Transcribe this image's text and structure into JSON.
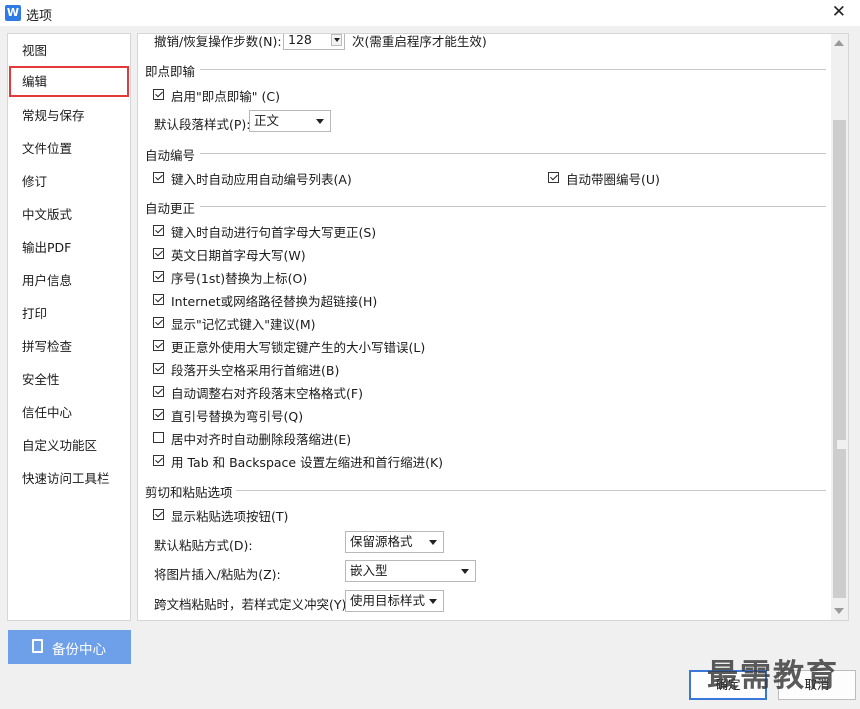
{
  "window": {
    "title": "选项",
    "app_icon_letter": "W",
    "close_glyph": "✕"
  },
  "sidebar": {
    "items": [
      {
        "label": "视图"
      },
      {
        "label": "编辑"
      },
      {
        "label": "常规与保存"
      },
      {
        "label": "文件位置"
      },
      {
        "label": "修订"
      },
      {
        "label": "中文版式"
      },
      {
        "label": "输出PDF"
      },
      {
        "label": "用户信息"
      },
      {
        "label": "打印"
      },
      {
        "label": "拼写检查"
      },
      {
        "label": "安全性"
      },
      {
        "label": "信任中心"
      },
      {
        "label": "自定义功能区"
      },
      {
        "label": "快速访问工具栏"
      }
    ],
    "active_index": 1,
    "backup_label": "备份中心"
  },
  "undo": {
    "label": "撤销/恢复操作步数(N):",
    "value": "128",
    "suffix": "次(需重启程序才能生效)"
  },
  "instant_input": {
    "title": "即点即输",
    "enable_label": "启用\"即点即输\" (C)",
    "enable_checked": true,
    "para_style_label": "默认段落样式(P):",
    "para_style_value": "正文"
  },
  "auto_number": {
    "title": "自动编号",
    "apply_list_label": "键入时自动应用自动编号列表(A)",
    "apply_list_checked": true,
    "circle_number_label": "自动带圈编号(U)",
    "circle_number_checked": true
  },
  "autocorrect": {
    "title": "自动更正",
    "items": [
      {
        "label": "键入时自动进行句首字母大写更正(S)",
        "checked": true
      },
      {
        "label": "英文日期首字母大写(W)",
        "checked": true
      },
      {
        "label": "序号(1st)替换为上标(O)",
        "checked": true
      },
      {
        "label": "Internet或网络路径替换为超链接(H)",
        "checked": true
      },
      {
        "label": "显示\"记忆式键入\"建议(M)",
        "checked": true
      },
      {
        "label": "更正意外使用大写锁定键产生的大小写错误(L)",
        "checked": true
      },
      {
        "label": "段落开头空格采用行首缩进(B)",
        "checked": true
      },
      {
        "label": "自动调整右对齐段落末空格格式(F)",
        "checked": true
      },
      {
        "label": "直引号替换为弯引号(Q)",
        "checked": true
      },
      {
        "label": "居中对齐时自动删除段落缩进(E)",
        "checked": false
      },
      {
        "label": "用 Tab 和 Backspace 设置左缩进和首行缩进(K)",
        "checked": true
      }
    ]
  },
  "paste": {
    "title": "剪切和粘贴选项",
    "show_button_label": "显示粘贴选项按钮(T)",
    "show_button_checked": true,
    "default_label": "默认粘贴方式(D):",
    "default_value": "保留源格式",
    "image_label": "将图片插入/粘贴为(Z):",
    "image_value": "嵌入型",
    "cross_doc_label": "跨文档粘贴时，若样式定义冲突(Y):",
    "cross_doc_value": "使用目标样式"
  },
  "buttons": {
    "ok": "确定",
    "cancel": "取消"
  },
  "watermark": "最需教育",
  "colors": {
    "accent": "#2f7be5",
    "active_border": "#e23a3a",
    "backup_bg": "#6ea0ea"
  }
}
